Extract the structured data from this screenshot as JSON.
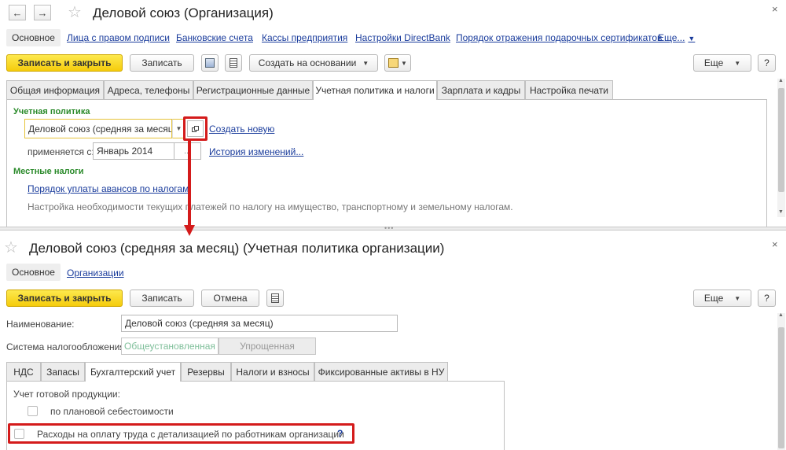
{
  "top": {
    "title": "Деловой союз (Организация)",
    "close": "×",
    "nav_back": "←",
    "nav_forward": "→",
    "star": "☆",
    "links": {
      "main": "Основное",
      "signers": "Лица с правом подписи",
      "bank_accounts": "Банковские счета",
      "cash_desks": "Кассы предприятия",
      "directbank": "Настройки DirectBank",
      "gift_cards": "Порядок отражения подарочных сертификатов",
      "more": "Еще..."
    },
    "toolbar": {
      "save_close": "Записать и закрыть",
      "save": "Записать",
      "create_based": "Создать на основании",
      "more": "Еще",
      "help": "?"
    },
    "tabs": [
      "Общая информация",
      "Адреса, телефоны",
      "Регистрационные данные",
      "Учетная политика и налоги",
      "Зарплата и кадры",
      "Настройка печати"
    ],
    "policy": {
      "section": "Учетная политика",
      "value": "Деловой союз (средняя за месяц)",
      "create_new": "Создать новую",
      "applies_label": "применяется с:",
      "applies_value": "Январь 2014",
      "history": "История изменений...",
      "local_taxes_section": "Местные налоги",
      "advance_order": "Порядок уплаты авансов по налогам",
      "note": "Настройка необходимости текущих платежей по налогу на имущество, транспортному и земельному налогам."
    }
  },
  "bottom": {
    "title": "Деловой союз (средняя за месяц) (Учетная политика организации)",
    "close": "×",
    "star": "☆",
    "links": {
      "main": "Основное",
      "organizations": "Организации"
    },
    "toolbar": {
      "save_close": "Записать и закрыть",
      "save": "Записать",
      "cancel": "Отмена",
      "more": "Еще",
      "help": "?"
    },
    "name_label": "Наименование:",
    "name_value": "Деловой союз (средняя за месяц)",
    "tax_label": "Система налогообложения:",
    "tax_options": [
      "Общеустановленная",
      "Упрощенная"
    ],
    "tabs": [
      "НДС",
      "Запасы",
      "Бухгалтерский учет",
      "Резервы",
      "Налоги и взносы",
      "Фиксированные активы в НУ"
    ],
    "finished_products_label": "Учет готовой продукции:",
    "planned_cost": "по плановой себестоимости",
    "labor_costs": "Расходы на оплату труда с детализацией по работникам организации",
    "labor_help": "?"
  },
  "colors": {
    "accent_yellow": "#f5cc0c",
    "highlight_red": "#d41b1b",
    "link_blue": "#1a3c9c",
    "section_green": "#2a8a2a"
  }
}
